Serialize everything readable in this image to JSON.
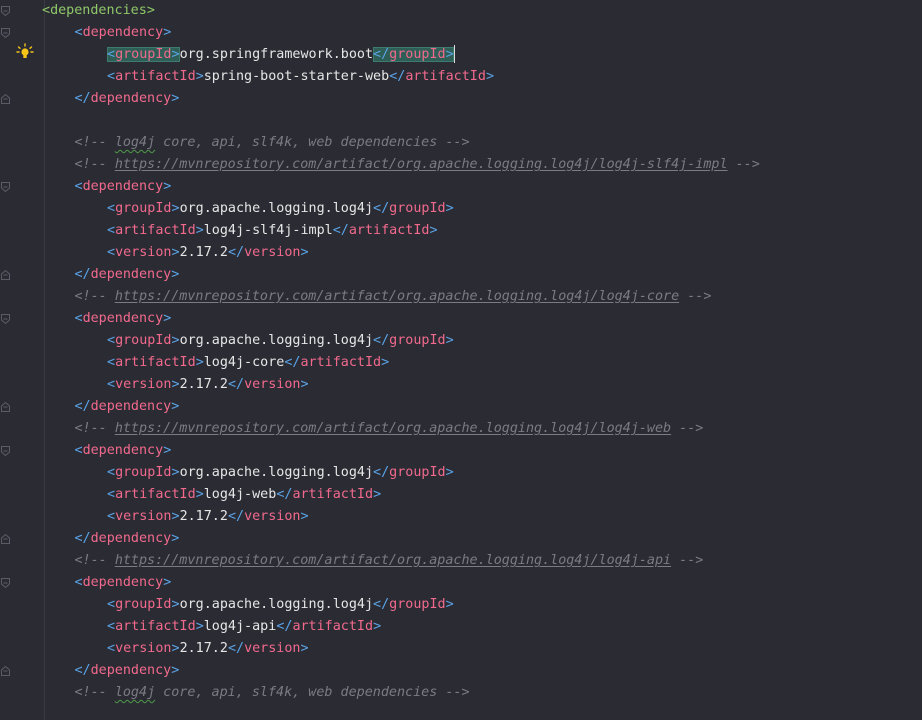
{
  "editor": {
    "lines": [
      {
        "type": "open",
        "indent": 0,
        "tag": "dependencies",
        "tagColor": "green"
      },
      {
        "type": "open",
        "indent": 1,
        "tag": "dependency"
      },
      {
        "type": "element",
        "indent": 2,
        "tag": "groupId",
        "value": "org.springframework.boot",
        "highlight": true
      },
      {
        "type": "element",
        "indent": 2,
        "tag": "artifactId",
        "value": "spring-boot-starter-web"
      },
      {
        "type": "close",
        "indent": 1,
        "tag": "dependency"
      },
      {
        "type": "blank"
      },
      {
        "type": "comment",
        "indent": 1,
        "pre": "<!-- ",
        "word": "log4j",
        "post": " core, api, slf4k, web dependencies -->"
      },
      {
        "type": "url-comment",
        "indent": 1,
        "url": "https://mvnrepository.com/artifact/org.apache.logging.log4j/log4j-slf4j-impl"
      },
      {
        "type": "open",
        "indent": 1,
        "tag": "dependency"
      },
      {
        "type": "element",
        "indent": 2,
        "tag": "groupId",
        "value": "org.apache.logging.log4j"
      },
      {
        "type": "element",
        "indent": 2,
        "tag": "artifactId",
        "value": "log4j-slf4j-impl"
      },
      {
        "type": "element",
        "indent": 2,
        "tag": "version",
        "value": "2.17.2"
      },
      {
        "type": "close",
        "indent": 1,
        "tag": "dependency"
      },
      {
        "type": "url-comment",
        "indent": 1,
        "url": "https://mvnrepository.com/artifact/org.apache.logging.log4j/log4j-core"
      },
      {
        "type": "open",
        "indent": 1,
        "tag": "dependency"
      },
      {
        "type": "element",
        "indent": 2,
        "tag": "groupId",
        "value": "org.apache.logging.log4j"
      },
      {
        "type": "element",
        "indent": 2,
        "tag": "artifactId",
        "value": "log4j-core"
      },
      {
        "type": "element",
        "indent": 2,
        "tag": "version",
        "value": "2.17.2"
      },
      {
        "type": "close",
        "indent": 1,
        "tag": "dependency"
      },
      {
        "type": "url-comment",
        "indent": 1,
        "url": "https://mvnrepository.com/artifact/org.apache.logging.log4j/log4j-web"
      },
      {
        "type": "open",
        "indent": 1,
        "tag": "dependency"
      },
      {
        "type": "element",
        "indent": 2,
        "tag": "groupId",
        "value": "org.apache.logging.log4j"
      },
      {
        "type": "element",
        "indent": 2,
        "tag": "artifactId",
        "value": "log4j-web"
      },
      {
        "type": "element",
        "indent": 2,
        "tag": "version",
        "value": "2.17.2"
      },
      {
        "type": "close",
        "indent": 1,
        "tag": "dependency"
      },
      {
        "type": "url-comment",
        "indent": 1,
        "url": "https://mvnrepository.com/artifact/org.apache.logging.log4j/log4j-api"
      },
      {
        "type": "open",
        "indent": 1,
        "tag": "dependency"
      },
      {
        "type": "element",
        "indent": 2,
        "tag": "groupId",
        "value": "org.apache.logging.log4j"
      },
      {
        "type": "element",
        "indent": 2,
        "tag": "artifactId",
        "value": "log4j-api"
      },
      {
        "type": "element",
        "indent": 2,
        "tag": "version",
        "value": "2.17.2"
      },
      {
        "type": "close",
        "indent": 1,
        "tag": "dependency"
      },
      {
        "type": "comment",
        "indent": 1,
        "pre": "<!-- ",
        "word": "log4j",
        "post": " core, api, slf4k, web dependencies -->"
      }
    ]
  },
  "colors": {
    "background": "#2b2b34",
    "tag": "#f16a8c",
    "bracket": "#5aa3e6",
    "outerTag": "#8fc868",
    "comment": "#7b7b86",
    "text": "#e6e6e6"
  },
  "icons": {
    "intention": "lightbulb-icon",
    "fold": "fold-marker-icon"
  }
}
